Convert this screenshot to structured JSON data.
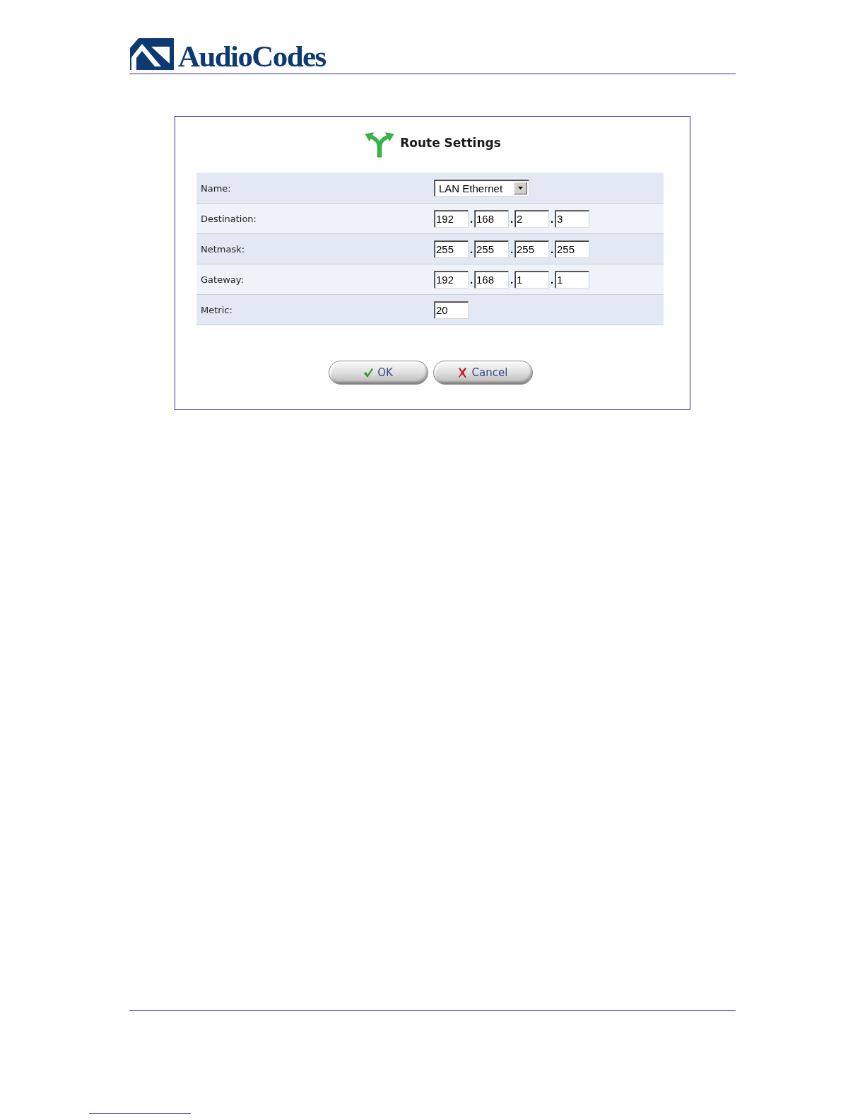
{
  "header": {
    "logo_text": "AudioCodes"
  },
  "dialog": {
    "title": "Route Settings",
    "fields": [
      {
        "kind": "select",
        "label": "Name:",
        "value": "LAN Ethernet"
      },
      {
        "kind": "ip",
        "label": "Destination:",
        "octets": [
          "192",
          "168",
          "2",
          "3"
        ],
        "separators": [
          ".",
          ".",
          "."
        ]
      },
      {
        "kind": "ip",
        "label": "Netmask:",
        "octets": [
          "255",
          "255",
          "255",
          "255"
        ],
        "separators": [
          ".",
          ".",
          "."
        ]
      },
      {
        "kind": "ip",
        "label": "Gateway:",
        "octets": [
          "192",
          "168",
          "1",
          "1"
        ],
        "separators": [
          ".",
          ".",
          "."
        ]
      },
      {
        "kind": "text",
        "label": "Metric:",
        "value": "20"
      }
    ],
    "buttons": [
      {
        "kind": "ok",
        "label": "OK"
      },
      {
        "kind": "cancel",
        "label": "Cancel"
      }
    ]
  }
}
